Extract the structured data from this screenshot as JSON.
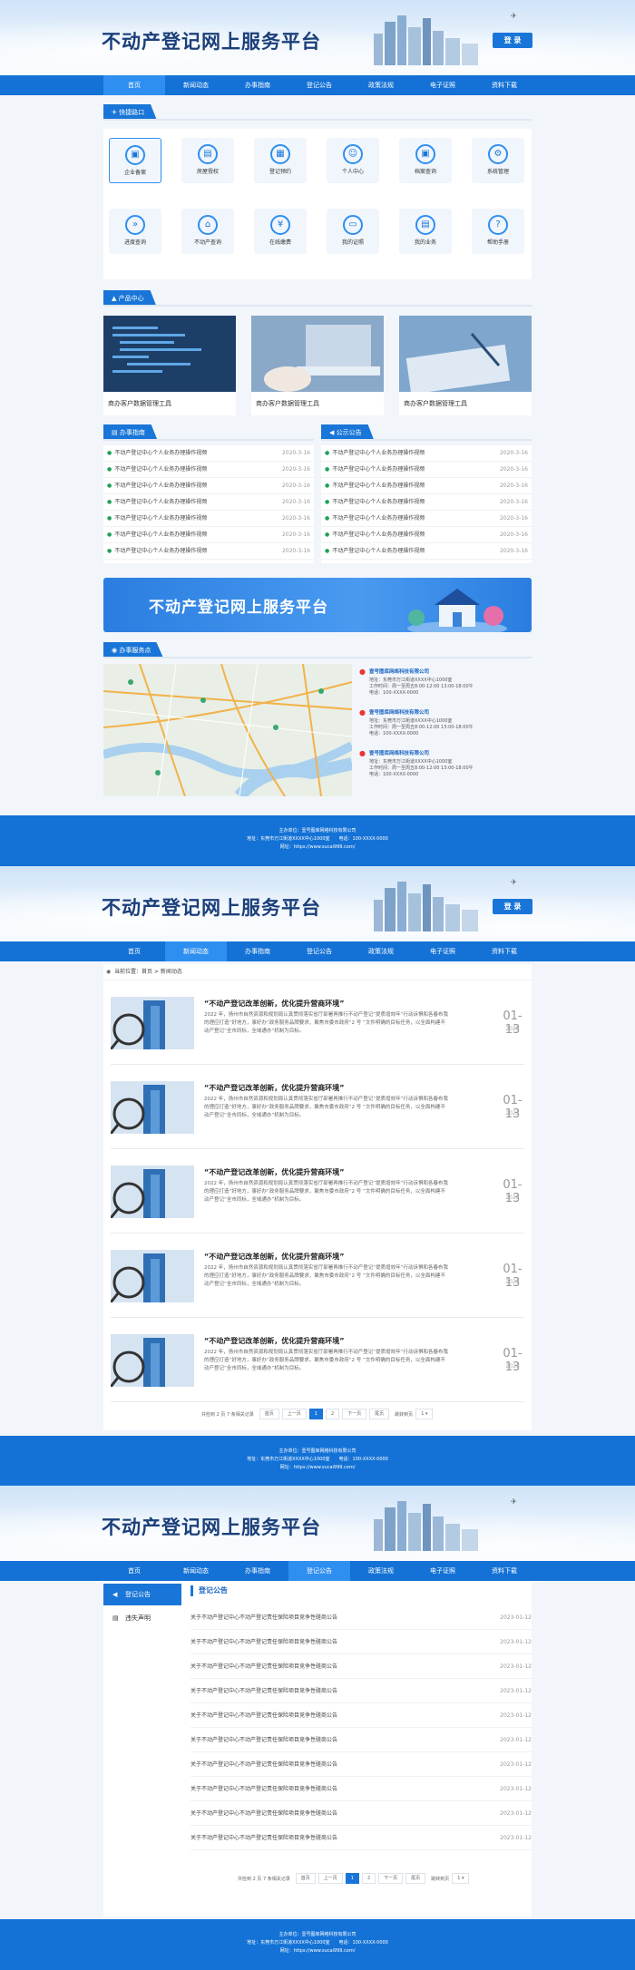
{
  "header": {
    "title": "不动产登记网上服务平台",
    "login": "登 录",
    "nav": [
      "首页",
      "新闻动态",
      "办事指南",
      "登记公告",
      "政策法规",
      "电子证照",
      "资料下载"
    ]
  },
  "home": {
    "quick_title": "快捷路口",
    "tiles": [
      "企业备案",
      "房屋授权",
      "登记预约",
      "个人中心",
      "档案查询",
      "系统管理",
      "进度查询",
      "不动产查询",
      "在线缴费",
      "我的证照",
      "我的业务",
      "帮助手册"
    ],
    "product_title": "产品中心",
    "products": [
      "商办客户数据管理工具",
      "商办客户数据管理工具",
      "商办客户数据管理工具"
    ],
    "guide_title": "办事指南",
    "notice_title": "公示公告",
    "list_text": "不动产登记中心个人业务办理操作视频",
    "list_date": "2020-3-16",
    "banner": "不动产登记网上服务平台",
    "points_title": "办事服务点",
    "points": [
      {
        "name": "壹号图库网络科技有限公司",
        "addr": "地址：东莞市万江街道XXXX中心1000室",
        "time": "工作时间：周一至周五8:00-12:00 13:00-18:00午",
        "tel": "电话：100-XXXX-0000"
      },
      {
        "name": "壹号图库网络科技有限公司",
        "addr": "地址：东莞市万江街道XXXX中心1000室",
        "time": "工作时间：周一至周五8:00-12:00 13:00-18:00午",
        "tel": "电话：100-XXXX-0000"
      },
      {
        "name": "壹号图库网络科技有限公司",
        "addr": "地址：东莞市万江街道XXXX中心1000室",
        "time": "工作时间：周一至周五8:00-12:00 13:00-18:00午",
        "tel": "电话：100-XXXX-0000"
      }
    ]
  },
  "footer": {
    "line1": "主办单位：壹号图库网络科技有限公司",
    "line2": "地址：东莞市万江街道XXXX中心1000室　　电话：100-XXXX-0000",
    "line3": "网址：https://www.sucai999.com/"
  },
  "news": {
    "crumb": "当前位置：首页 > 新闻动态",
    "title": "“不动产登记改革创新，优化提升营商环境”",
    "desc": "2022 年，扬州市自然资源和规划局认真贯彻落实省厅部署再推行不动产登记“提质增效年”行动诉惧和各春布我的理应打造“好地方，事好办”政务服务品牌要求，聚焦市委市政府“2 号 ”文件明确的目标任务，以全面构建不动产登记“全市同标，全域通办”机制为目标。",
    "day": "01-13",
    "year": "2023",
    "pager": {
      "info": "共检到 2 页 7 条相关记录",
      "first": "首页",
      "prev": "上一页",
      "p1": "1",
      "p2": "2",
      "next": "下一页",
      "last": "尾页",
      "jump": "跳转到页",
      "sel": "1 ▾"
    }
  },
  "notice": {
    "crumb": "当前位置：首页 > 登记公告",
    "side": [
      "登记公告",
      "违失声明"
    ],
    "title": "登记公告",
    "row_text": "关于不动产登记中心不动产登记责任保险项目竞争性磋商公告",
    "row_date": "2023-01-12"
  }
}
